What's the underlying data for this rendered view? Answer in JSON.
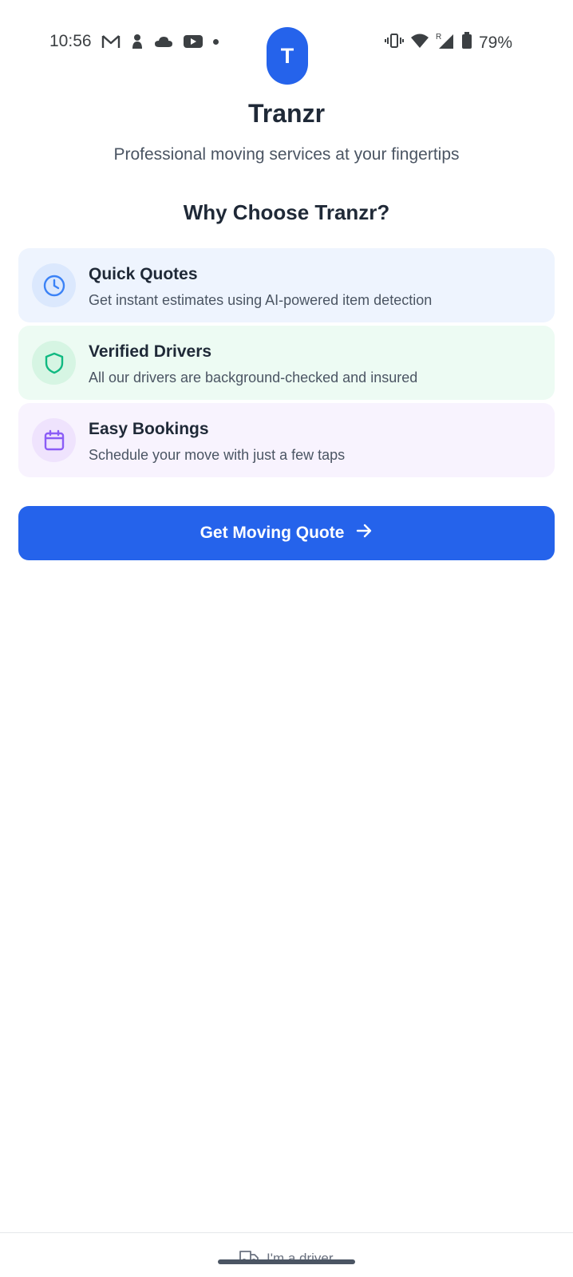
{
  "status_bar": {
    "time": "10:56",
    "battery": "79%",
    "icons_left": [
      "gmail-icon",
      "notification-icon",
      "cloud-icon",
      "youtube-icon",
      "dot-icon"
    ],
    "icons_right": [
      "vibrate-icon",
      "wifi-icon",
      "signal-roaming-icon",
      "battery-icon"
    ],
    "roaming": "R"
  },
  "app": {
    "logo_letter": "T",
    "title": "Tranzr",
    "subtitle": "Professional moving services at your fingertips"
  },
  "why": {
    "title": "Why Choose Tranzr?",
    "features": [
      {
        "title": "Quick Quotes",
        "desc": "Get instant estimates using AI-powered item detection",
        "icon": "clock-icon",
        "color": "#3b82f6"
      },
      {
        "title": "Verified Drivers",
        "desc": "All our drivers are background-checked and insured",
        "icon": "shield-icon",
        "color": "#10b981"
      },
      {
        "title": "Easy Bookings",
        "desc": "Schedule your move with just a few taps",
        "icon": "calendar-icon",
        "color": "#8b5cf6"
      }
    ]
  },
  "cta": {
    "label": "Get Moving Quote",
    "color": "#2563eb"
  },
  "footer": {
    "driver_link": "I'm a driver",
    "icon": "truck-icon"
  }
}
